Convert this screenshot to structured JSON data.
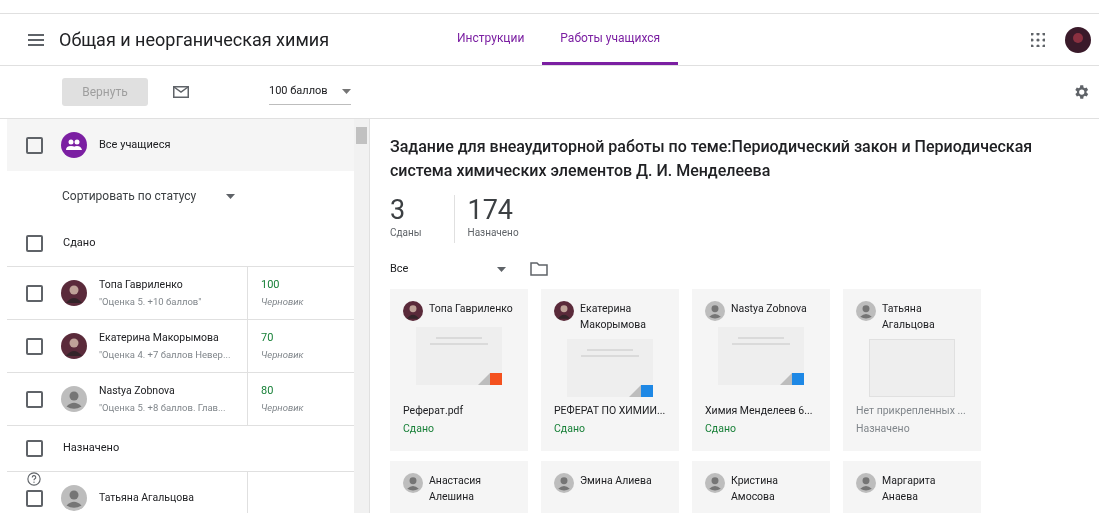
{
  "header": {
    "course_title": "Общая и неорганическая химия",
    "tabs": [
      {
        "label": "Инструкции",
        "selected": false
      },
      {
        "label": "Работы учащихся",
        "selected": true
      }
    ]
  },
  "toolbar": {
    "return_button": {
      "label": "Вернуть",
      "disabled": true
    },
    "points": "100 баллов"
  },
  "roster": {
    "all_students": {
      "label": "Все учащиеся",
      "checked": false
    },
    "sort": "Сортировать по статусу",
    "groups": [
      {
        "label": "Сдано",
        "checked": false,
        "students": [
          {
            "name": "Топа Гавриленко",
            "comment": "\"Оценка 5. +10 баллов\"",
            "grade": "100",
            "grade_status": "Черновик",
            "avatar": {
              "kind": "photo"
            },
            "checked": false
          },
          {
            "name": "Екатерина Макорымова",
            "comment": "\"Оценка 4. +7 баллов Невер...",
            "grade": "70",
            "grade_status": "Черновик",
            "avatar": {
              "kind": "photo"
            },
            "checked": false
          },
          {
            "name": "Nastya Zobnova",
            "comment": "\"Оценка 5. +8 баллов. Глав...",
            "grade": "80",
            "grade_status": "Черновик",
            "avatar": {
              "kind": "default"
            },
            "checked": false
          }
        ]
      },
      {
        "label": "Назначено",
        "checked": false,
        "students": [
          {
            "name": "Татьяна Агальцова",
            "avatar": {
              "kind": "default"
            },
            "checked": false
          }
        ]
      }
    ]
  },
  "assignment": {
    "title": "Задание для внеаудиторной работы по теме:Периодический закон и Периодическая система химических элементов Д. И. Менделеева",
    "stats": [
      {
        "value": "3",
        "label": "Сданы"
      },
      {
        "value": "174",
        "label": "Назначено"
      }
    ],
    "filter": "Все",
    "cards": [
      {
        "name": "Топа Гавриленко",
        "avatar": {
          "kind": "photo"
        },
        "attachment": {
          "kind": "pdf"
        },
        "file": "Реферат.pdf",
        "status": {
          "label": "Сдано",
          "color": "#188038"
        }
      },
      {
        "name": "Екатерина Макорымова",
        "avatar": {
          "kind": "photo"
        },
        "attachment": {
          "kind": "doc"
        },
        "file": "РЕФЕРАТ ПО ХИМИИ...",
        "status": {
          "label": "Сдано",
          "color": "#188038"
        }
      },
      {
        "name": "Nastya Zobnova",
        "avatar": {
          "kind": "default"
        },
        "attachment": {
          "kind": "doc"
        },
        "file": "Химия Менделеев 6...",
        "status": {
          "label": "Сдано",
          "color": "#188038"
        }
      },
      {
        "name": "Татьяна Агальцова",
        "avatar": {
          "kind": "default"
        },
        "attachment": {
          "kind": "none"
        },
        "file": "Нет прикрепленных ...",
        "status": {
          "label": "Назначено",
          "color": "#80868b"
        }
      },
      {
        "name": "Анастасия Алешина",
        "avatar": {
          "kind": "default"
        }
      },
      {
        "name": "Эмина Алиева",
        "avatar": {
          "kind": "default"
        }
      },
      {
        "name": "Кристина Амосова",
        "avatar": {
          "kind": "default"
        }
      },
      {
        "name": "Маргарита Анаева",
        "avatar": {
          "kind": "default"
        }
      }
    ]
  }
}
